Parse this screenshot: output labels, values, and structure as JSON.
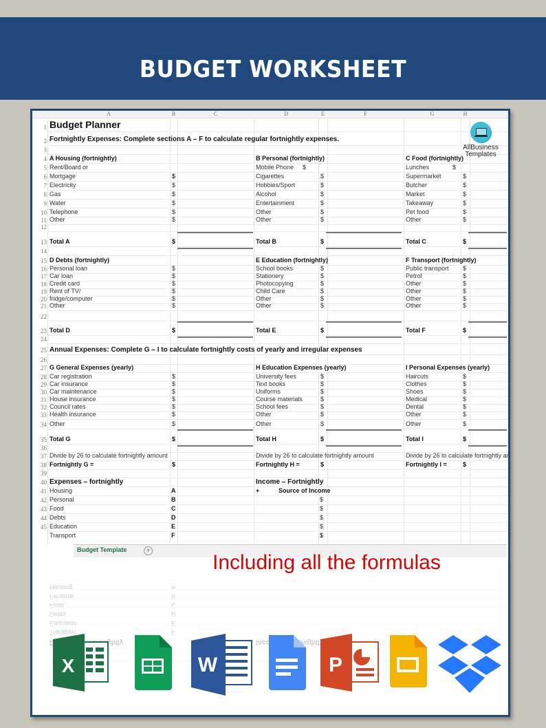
{
  "banner": {
    "title": "BUDGET WORKSHEET"
  },
  "colors": {
    "banner": "#1f497d",
    "background": "#c8c6bb",
    "tagline": "#e00000",
    "tab": "#217346"
  },
  "logo": {
    "line1": "AllBusiness",
    "line2": "Templates",
    "icon": "laptop-icon"
  },
  "columns": [
    "A",
    "B",
    "C",
    "D",
    "E",
    "F",
    "G",
    "H"
  ],
  "sheet": {
    "title": "Budget Planner",
    "subtitle": "Fortnightly Expenses: Complete sections A – F to calculate regular fortnightly expenses.",
    "annual_heading": "Annual Expenses: Complete G – I to calculate fortnightly costs of yearly and irregular expenses",
    "row_numbers": [
      "1",
      "2",
      "3",
      "4",
      "5",
      "6",
      "7",
      "8",
      "9",
      "10",
      "11",
      "12",
      "13",
      "14",
      "15",
      "16",
      "17",
      "18",
      "19",
      "20",
      "21",
      "22",
      "23",
      "24",
      "25",
      "26",
      "27",
      "28",
      "29",
      "30",
      "31",
      "32",
      "33",
      "34",
      "35",
      "36",
      "37",
      "38",
      "39",
      "40",
      "41",
      "42",
      "43",
      "44",
      "45"
    ],
    "sections": {
      "A": {
        "title": "A Housing (fortnightly)",
        "items": [
          "Rent/Board or",
          "Mortgage",
          "Electricity",
          "Gas",
          "Water",
          "Telephone",
          "Other"
        ],
        "total": "Total A"
      },
      "B": {
        "title": "B Personal (fortnightly)",
        "items": [
          "Mobile Phone",
          "Cigarettes",
          "Hobbies/Sport",
          "Alcohol",
          "Entertainment",
          "Other",
          "Other"
        ],
        "total": "Total B"
      },
      "C": {
        "title": "C Food (fortnightly)",
        "items": [
          "Lunches",
          "Supermarket",
          "Butcher",
          "Market",
          "Takeaway",
          "Pet food",
          "Other"
        ],
        "total": "Total C"
      },
      "D": {
        "title": "D Debts (fortnightly)",
        "items": [
          "Personal loan",
          "Car loan",
          "Credit card",
          "Rent of TV/",
          "fridge/computer",
          "Other"
        ],
        "total": "Total D"
      },
      "E": {
        "title": "E Education (fortnightly)",
        "items": [
          "School books",
          "Stationery",
          "Photocopying",
          "Child Care",
          "Other",
          "Other"
        ],
        "total": "Total E"
      },
      "F": {
        "title": "F Transport (fortnightly)",
        "items": [
          "Public transport",
          "Petrol",
          "Other",
          "Other",
          "Other",
          "Other"
        ],
        "total": "Total F"
      },
      "G": {
        "title": "G General Expenses (yearly)",
        "items": [
          "Car registration",
          "Car insurance",
          "Car maintenance",
          "House insurance",
          "Council rates",
          "Health insurance",
          "Other"
        ],
        "total": "Total G",
        "divide": "Divide by 26 to calculate fortnightly amount",
        "fortnightly": "Fortnightly G ="
      },
      "H": {
        "title": "H Education Expenses (yearly)",
        "items": [
          "University fees",
          "Text books",
          "Uniforms",
          "Course materials",
          "School fees",
          "Other",
          "Other"
        ],
        "total": "Total H",
        "divide": "Divide by 26 to calculate fortnightly amount",
        "fortnightly": "Fortnightly H ="
      },
      "I": {
        "title": "I Personal Expenses (yearly)",
        "items": [
          "Haircuts",
          "Clothes",
          "Shoes",
          "Medical",
          "Dental",
          "Other",
          "Other"
        ],
        "total": "Total I",
        "divide": "Divide by 26 to calculate fortnightly an",
        "fortnightly": "Fortnightly I ="
      }
    },
    "currency": "$",
    "summary": {
      "expenses_title": "Expenses – fortnightly",
      "expenses": [
        {
          "label": "Housing",
          "code": "A"
        },
        {
          "label": "Personal",
          "code": "B"
        },
        {
          "label": "Food",
          "code": "C"
        },
        {
          "label": "Debts",
          "code": "D"
        },
        {
          "label": "Education",
          "code": "E"
        },
        {
          "label": "Transport",
          "code": "F"
        }
      ],
      "income_title": "Income – Fortnightly",
      "income_plus": "+",
      "income_header": "Source of Income"
    },
    "tab_label": "Budget Template",
    "tab_add": "+"
  },
  "tagline": "Including all the formulas",
  "apps": [
    "excel-icon",
    "google-sheets-icon",
    "word-icon",
    "google-docs-icon",
    "powerpoint-icon",
    "google-slides-icon",
    "dropbox-icon"
  ]
}
